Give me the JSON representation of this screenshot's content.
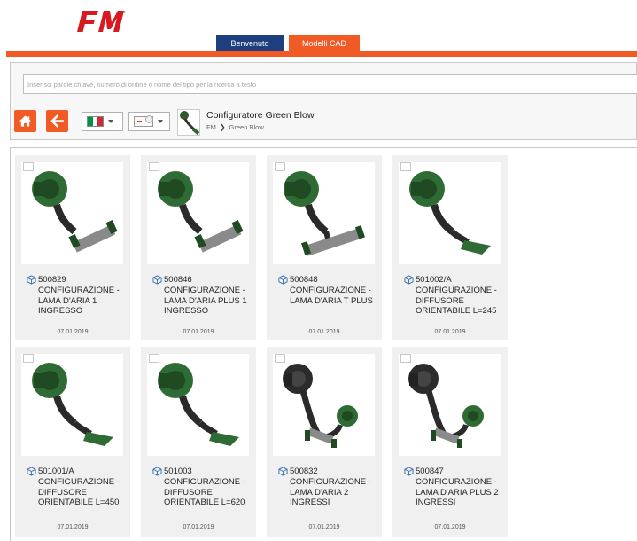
{
  "brand": {
    "logo_text": "FM",
    "accent": "#f15a24",
    "navy": "#1d3f7e"
  },
  "tabs": [
    {
      "label": "Benvenuto",
      "active": false
    },
    {
      "label": "Modelli CAD",
      "active": true
    }
  ],
  "search": {
    "placeholder": "Inserisci parole chiave, numero di ordine o nome del tipo per la ricerca a testo",
    "value": ""
  },
  "toolbar": {
    "home_icon": "home-icon",
    "back_icon": "arrow-left-icon",
    "language_selected": "Italiano",
    "format_selected": "Formato CAD"
  },
  "configurator": {
    "title": "Configuratore Green Blow",
    "breadcrumb": [
      "FM",
      "Green Blow"
    ]
  },
  "products": [
    {
      "code": "500829",
      "desc": [
        "CONFIGURAZIONE -",
        "LAMA D'ARIA 1",
        "INGRESSO"
      ],
      "date": "07.01.2019",
      "variant": "single"
    },
    {
      "code": "500846",
      "desc": [
        "CONFIGURAZIONE -",
        "LAMA D'ARIA PLUS 1",
        "INGRESSO"
      ],
      "date": "07.01.2019",
      "variant": "single"
    },
    {
      "code": "500848",
      "desc": [
        "CONFIGURAZIONE -",
        "LAMA D'ARIA T PLUS"
      ],
      "date": "07.01.2019",
      "variant": "tee"
    },
    {
      "code": "501002/A",
      "desc": [
        "CONFIGURAZIONE -",
        "DIFFUSORE",
        "ORIENTABILE L=245"
      ],
      "date": "07.01.2019",
      "variant": "diffuser"
    },
    {
      "code": "501001/A",
      "desc": [
        "CONFIGURAZIONE -",
        "DIFFUSORE",
        "ORIENTABILE L=450"
      ],
      "date": "07.01.2019",
      "variant": "diffuser"
    },
    {
      "code": "501003",
      "desc": [
        "CONFIGURAZIONE -",
        "DIFFUSORE",
        "ORIENTABILE L=620"
      ],
      "date": "07.01.2019",
      "variant": "diffuser"
    },
    {
      "code": "500832",
      "desc": [
        "CONFIGURAZIONE -",
        "LAMA D'ARIA 2",
        "INGRESSI"
      ],
      "date": "07.01.2019",
      "variant": "double"
    },
    {
      "code": "500847",
      "desc": [
        "CONFIGURAZIONE -",
        "LAMA D'ARIA PLUS 2",
        "INGRESSI"
      ],
      "date": "07.01.2019",
      "variant": "double"
    }
  ]
}
